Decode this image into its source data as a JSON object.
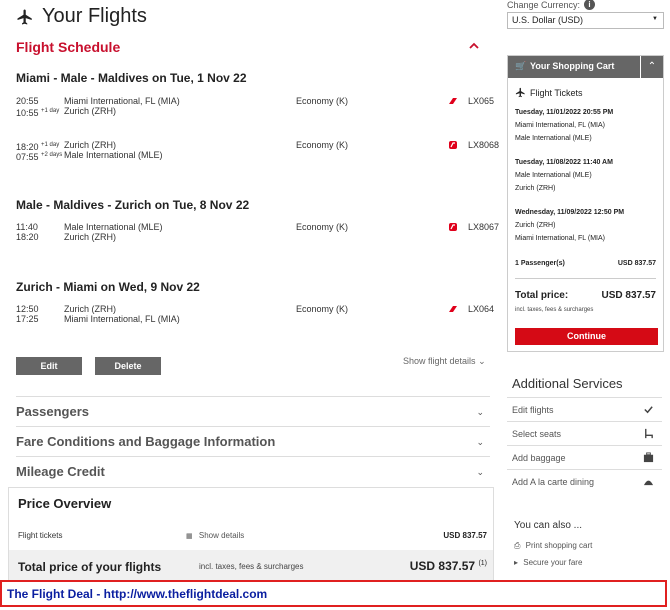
{
  "header": {
    "title": "Your Flights",
    "section_title": "Flight Schedule"
  },
  "currency": {
    "label": "Change Currency:",
    "value": "U.S. Dollar (USD)"
  },
  "routes": [
    {
      "title": "Miami - Male - Maldives on Tue, 1 Nov 22",
      "segments": [
        {
          "dep_time": "20:55",
          "arr_time": "10:55",
          "arr_sup": "+1 day",
          "dep_ap": "Miami International, FL (MIA)",
          "arr_ap": "Zurich (ZRH)",
          "class": "Economy (K)",
          "flight": "LX065"
        },
        {
          "dep_time": "18:20",
          "dep_sup": "+1 day",
          "arr_time": "07:55",
          "arr_sup": "+2 days",
          "dep_ap": "Zurich (ZRH)",
          "arr_ap": "Male International (MLE)",
          "class": "Economy (K)",
          "flight": "LX8068"
        }
      ]
    },
    {
      "title": "Male - Maldives - Zurich on Tue, 8 Nov 22",
      "segments": [
        {
          "dep_time": "11:40",
          "arr_time": "18:20",
          "dep_ap": "Male International (MLE)",
          "arr_ap": "Zurich (ZRH)",
          "class": "Economy (K)",
          "flight": "LX8067"
        }
      ]
    },
    {
      "title": "Zurich - Miami on Wed, 9 Nov 22",
      "segments": [
        {
          "dep_time": "12:50",
          "arr_time": "17:25",
          "dep_ap": "Zurich (ZRH)",
          "arr_ap": "Miami International, FL (MIA)",
          "class": "Economy (K)",
          "flight": "LX064"
        }
      ]
    }
  ],
  "actions": {
    "edit": "Edit",
    "delete": "Delete",
    "show_flight_details": "Show flight details"
  },
  "accordions": [
    "Passengers",
    "Fare Conditions and Baggage Information",
    "Mileage Credit"
  ],
  "price_overview": {
    "title": "Price Overview",
    "tickets_label": "Flight tickets",
    "show_details": "Show details",
    "tickets_value": "USD 837.57",
    "total_label": "Total price of your flights",
    "total_note": "incl. taxes, fees & surcharges",
    "total_value": "USD 837.57",
    "total_sup": "(1)"
  },
  "cart": {
    "title": "Your Shopping Cart",
    "section": "Flight Tickets",
    "legs": [
      {
        "date": "Tuesday, 11/01/2022 20:55 PM",
        "from": "Miami International, FL (MIA)",
        "to": "Male International (MLE)"
      },
      {
        "date": "Tuesday, 11/08/2022 11:40 AM",
        "from": "Male International (MLE)",
        "to": "Zurich (ZRH)"
      },
      {
        "date": "Wednesday, 11/09/2022 12:50 PM",
        "from": "Zurich (ZRH)",
        "to": "Miami International, FL (MIA)"
      }
    ],
    "passengers_label": "1 Passenger(s)",
    "passengers_value": "USD 837.57",
    "total_label": "Total price:",
    "total_value": "USD 837.57",
    "total_note": "incl. taxes, fees & surcharges",
    "continue": "Continue"
  },
  "additional": {
    "title": "Additional Services",
    "items": [
      "Edit flights",
      "Select seats",
      "Add baggage",
      "Add A la carte dining"
    ]
  },
  "also": {
    "title": "You can also ...",
    "items": [
      "Print shopping cart",
      "Secure your fare"
    ]
  },
  "footer": "The Flight Deal - http://www.theflightdeal.com",
  "colors": {
    "accent": "#c8102e",
    "button": "#666666",
    "continue": "#d50a15",
    "footer_text": "#0a1ea0"
  }
}
